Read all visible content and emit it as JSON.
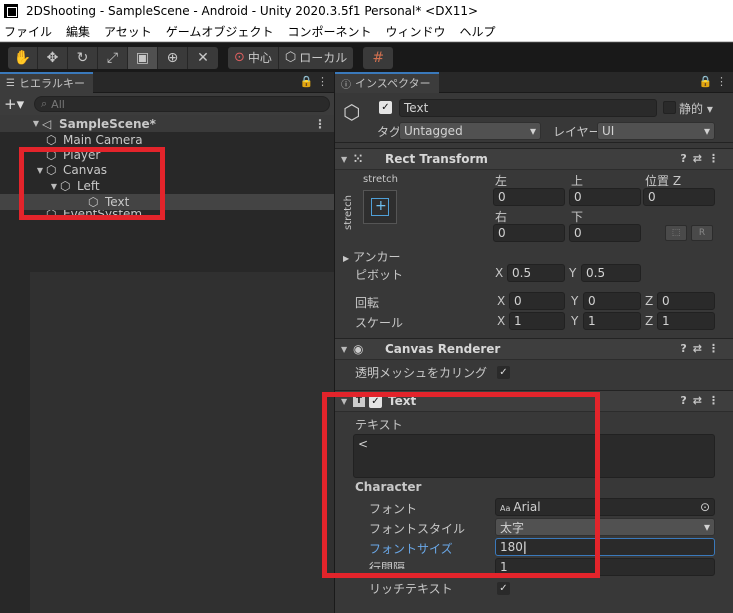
{
  "window": {
    "title": "2DShooting - SampleScene - Android - Unity 2020.3.5f1 Personal* <DX11>"
  },
  "menu": [
    "ファイル",
    "編集",
    "アセット",
    "ゲームオブジェクト",
    "コンポーネント",
    "ウィンドウ",
    "ヘルプ"
  ],
  "toolbar": {
    "tools": [
      "hand-tool",
      "move-tool",
      "rotate-tool",
      "scale-tool",
      "rect-tool",
      "transform-tool",
      "custom-tool"
    ],
    "pivot_label": "中心",
    "space_label": "ローカル"
  },
  "hierarchy": {
    "tab_label": "ヒエラルキー",
    "search_placeholder": "All",
    "items": [
      {
        "label": "SampleScene*",
        "depth": 0
      },
      {
        "label": "Main Camera",
        "depth": 1
      },
      {
        "label": "Player",
        "depth": 1
      },
      {
        "label": "Canvas",
        "depth": 1
      },
      {
        "label": "Left",
        "depth": 2
      },
      {
        "label": "Text",
        "depth": 3
      },
      {
        "label": "EventSystem",
        "depth": 1
      }
    ]
  },
  "inspector": {
    "tab_label": "インスペクター",
    "object_name": "Text",
    "static_label": "静的",
    "tag_label": "タグ",
    "tag_value": "Untagged",
    "layer_label": "レイヤー",
    "layer_value": "UI",
    "rect_transform": {
      "title": "Rect Transform",
      "stretch_h": "stretch",
      "stretch_v": "stretch",
      "left_label": "左",
      "top_label": "上",
      "posz_label": "位置 Z",
      "right_label": "右",
      "bottom_label": "下",
      "left": "0",
      "top": "0",
      "posz": "0",
      "right": "0",
      "bottom": "0",
      "anchor_label": "アンカー",
      "pivot_label": "ピボット",
      "pivot_x": "0.5",
      "pivot_y": "0.5",
      "rotation_label": "回転",
      "rot_x": "0",
      "rot_y": "0",
      "rot_z": "0",
      "scale_label": "スケール",
      "scale_x": "1",
      "scale_y": "1",
      "scale_z": "1",
      "r_button": "R"
    },
    "canvas_renderer": {
      "title": "Canvas Renderer",
      "cull_label": "透明メッシュをカリング"
    },
    "text": {
      "title": "Text",
      "text_label": "テキスト",
      "text_value": "<",
      "character_label": "Character",
      "font_label": "フォント",
      "font_value": "Arial",
      "font_prefix": "Aa",
      "style_label": "フォントスタイル",
      "style_value": "太字",
      "size_label": "フォントサイズ",
      "size_value": "180",
      "line_spacing_label": "行間隔",
      "line_spacing_value": "1",
      "rich_text_label": "リッチテキスト"
    }
  },
  "colors": {
    "annotation": "#e3242b",
    "accent": "#3a79bb"
  }
}
